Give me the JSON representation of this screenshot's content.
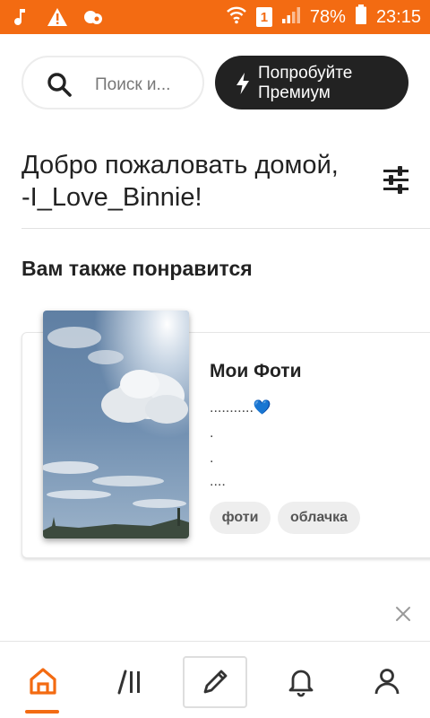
{
  "status_bar": {
    "battery_percent": "78%",
    "time": "23:15",
    "sim_label": "1",
    "icons": [
      "music-note-icon",
      "warning-icon",
      "cloud-settings-icon",
      "wifi-icon",
      "signal-icon",
      "battery-icon"
    ]
  },
  "header": {
    "search_placeholder": "Поиск и...",
    "premium_label": "Попробуйте Премиум"
  },
  "welcome": {
    "line1": "Добро пожаловать домой,",
    "line2": "-I_Love_Binnie!"
  },
  "section": {
    "title": "Вам также понравится"
  },
  "story": {
    "title": "Мои Фоти",
    "description_lines": [
      "...........💙",
      ".",
      ".",
      "...."
    ],
    "tags": [
      "фоти",
      "облачка"
    ]
  },
  "bottom_nav": {
    "items": [
      "home-icon",
      "library-icon",
      "write-icon",
      "notifications-icon",
      "profile-icon"
    ],
    "active": "home-icon"
  },
  "colors": {
    "accent": "#f36b12",
    "dark_button": "#222222",
    "tag_bg": "#eeeeee"
  }
}
